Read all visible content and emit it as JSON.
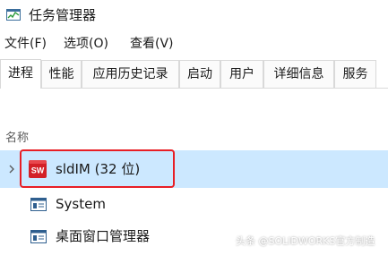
{
  "window": {
    "title": "任务管理器",
    "icon": "task-manager-icon"
  },
  "menu": [
    "文件(F)",
    "选项(O)",
    "查看(V)"
  ],
  "tabs": [
    {
      "label": "进程",
      "active": true
    },
    {
      "label": "性能",
      "active": false
    },
    {
      "label": "应用历史记录",
      "active": false
    },
    {
      "label": "启动",
      "active": false
    },
    {
      "label": "用户",
      "active": false
    },
    {
      "label": "详细信息",
      "active": false
    },
    {
      "label": "服务",
      "active": false
    }
  ],
  "table": {
    "column_name": "名称"
  },
  "processes": [
    {
      "name": "sldIM (32 位)",
      "icon": "solidworks-sw-icon",
      "expandable": true,
      "selected": true,
      "highlighted": true
    },
    {
      "name": "System",
      "icon": "system-process-icon",
      "expandable": false,
      "selected": false,
      "highlighted": false
    },
    {
      "name": "桌面窗口管理器",
      "icon": "window-process-icon",
      "expandable": false,
      "selected": false,
      "highlighted": false
    }
  ],
  "watermark": "头条 @SOLIDWORKS官方制造",
  "colors": {
    "selection": "#cce8ff",
    "highlight_border": "#e81e25",
    "sw_icon": "#d32027"
  }
}
